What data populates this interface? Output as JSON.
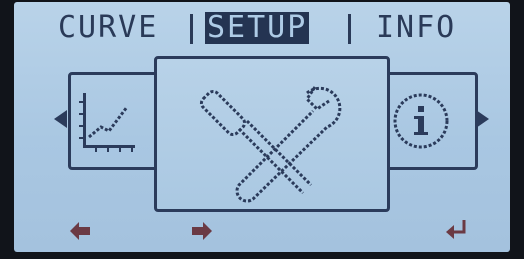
{
  "tabs": [
    {
      "label": "CURVE",
      "active": false
    },
    {
      "label": "SETUP",
      "active": true
    },
    {
      "label": "INFO",
      "active": false
    }
  ],
  "menu": {
    "items": [
      {
        "name": "curve",
        "icon": "chart-icon"
      },
      {
        "name": "setup",
        "icon": "tools-icon"
      },
      {
        "name": "info",
        "icon": "info-icon"
      }
    ]
  },
  "softkeys": [
    {
      "icon": "arrow-left-icon"
    },
    {
      "icon": "arrow-right-icon"
    },
    {
      "icon": "enter-icon"
    }
  ],
  "colors": {
    "lcd_background": "#b9d3e9",
    "pixel_dark": "#2b3b5b",
    "bezel": "#11141a"
  }
}
